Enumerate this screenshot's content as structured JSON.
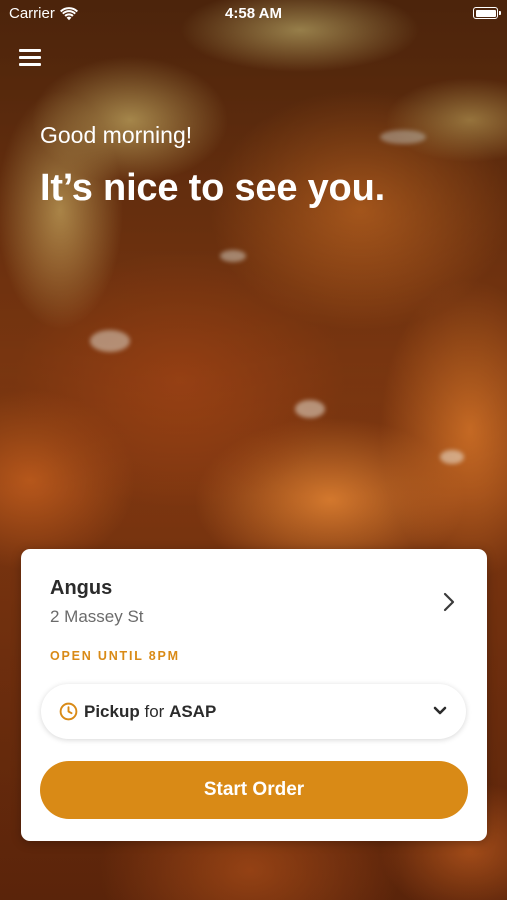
{
  "status_bar": {
    "carrier": "Carrier",
    "time": "4:58 AM",
    "icons": [
      "wifi-icon",
      "battery-icon"
    ]
  },
  "header": {
    "menu_icon": "hamburger-menu-icon",
    "greeting": "Good morning!",
    "headline": "It’s nice to see you."
  },
  "store_card": {
    "name": "Angus",
    "address": "2 Massey St",
    "hours": "OPEN UNTIL 8PM",
    "order_type": {
      "mode": "Pickup",
      "connector": "for",
      "time": "ASAP"
    },
    "start_order_label": "Start Order"
  },
  "colors": {
    "accent": "#d98a16",
    "card_background": "#ffffff",
    "primary_text": "#2b2b2b",
    "secondary_text": "#6b6b6b"
  }
}
